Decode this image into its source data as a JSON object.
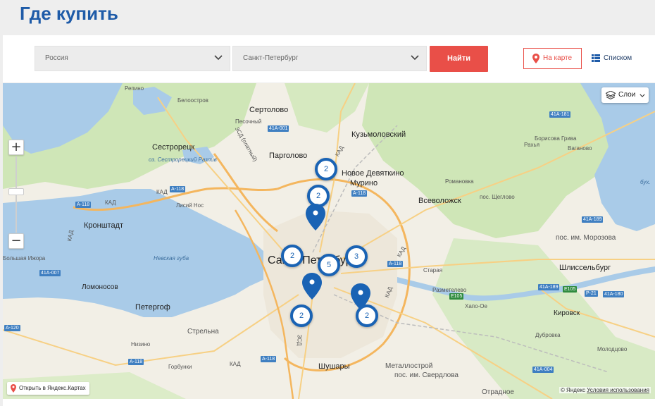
{
  "page": {
    "title": "Где купить"
  },
  "filters": {
    "country": "Россия",
    "city": "Санкт-Петербург",
    "find_label": "Найти",
    "view_map_label": "На карте",
    "view_list_label": "Списком"
  },
  "colors": {
    "title": "#1e5ba8",
    "accent": "#e94f48",
    "marker": "#1a63b4"
  },
  "map": {
    "layers_label": "Слои",
    "open_yandex_label": "Открыть в Яндекс.Картах",
    "attribution": "© Яндекс",
    "terms_label": "Условия использования",
    "zoom_in": "+",
    "zoom_out": "−",
    "clusters": [
      "2",
      "2",
      "2",
      "5",
      "3",
      "2",
      "2"
    ],
    "labels": {
      "repino": "Репино",
      "beloostrov": "Белоостров",
      "sertolovo": "Сертолово",
      "pesochny": "Песочный",
      "kuzmolovsky": "Кузьмоловский",
      "sestroretsk": "Сестрорецк",
      "pargolovo": "Парголово",
      "novoe_devyatkino": "Новое Девяткино",
      "murino": "Мурино",
      "romanovka": "Романовка",
      "vsevolozhsk": "Всеволожск",
      "shchegolovo": "пос. Щеглово",
      "morozova": "пос. им. Морозова",
      "shlisselburg": "Шлиссельбург",
      "kronshtadt": "Кронштадт",
      "lisiy_nos": "Лисий Нос",
      "nevskaya_guba": "Невская губа",
      "spb": "Санкт-Петербург",
      "bolshaya_izhora": "Большая Ижора",
      "lomonosov": "Ломоносов",
      "peterhof": "Петергоф",
      "strelna": "Стрельна",
      "nizino": "Низино",
      "gorbunki": "Горбунки",
      "shushary": "Шушары",
      "metallostroy": "Металлострой",
      "sverdlova": "пос. им. Свердлова",
      "otradnoe": "Отрадное",
      "staraya": "Старая",
      "razmetelevo": "Разметелево",
      "khapo_oe": "Хапо-Ое",
      "kirovsk": "Кировск",
      "dubrovka": "Дубровка",
      "molodtsovo": "Молодцово",
      "borisova_griva": "Борисова Грива",
      "vaganovo": "Ваганово",
      "rakhya": "Рахья",
      "razliv": "оз. Сестрорецкий Разлив",
      "bukh": "бух.",
      "zsd": "ЗСД",
      "zsd_paid": "ЗСД (платный)",
      "kad": "КАД"
    },
    "roads": {
      "a181": "41А-181",
      "a001": "41А-001",
      "a118": "А-118",
      "a007": "41А-007",
      "a120": "А-120",
      "a004": "41А-004",
      "a189": "41А-189",
      "a180": "41А-180",
      "e105": "Е105",
      "p21": "Р-21"
    }
  }
}
